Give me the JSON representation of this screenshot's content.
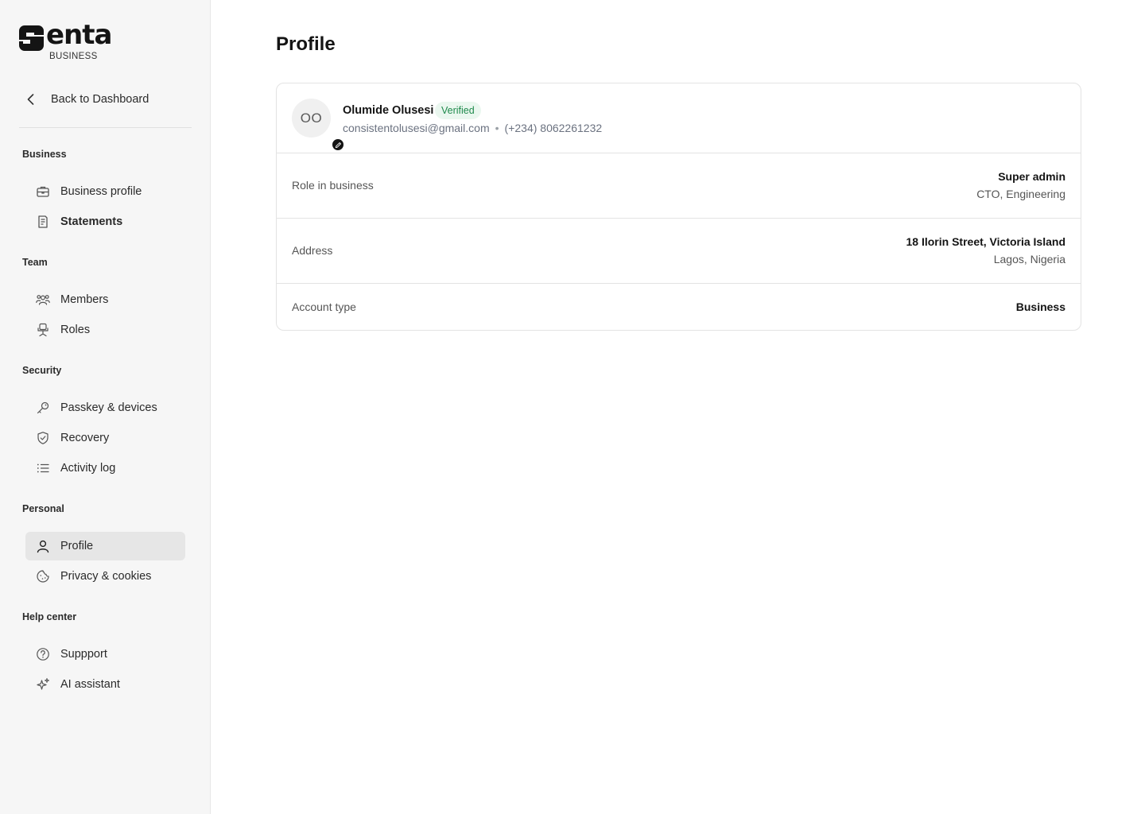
{
  "brand": {
    "name": "enta",
    "subtitle": "BUSINESS"
  },
  "sidebar": {
    "back_label": "Back to Dashboard",
    "sections": [
      {
        "title": "Business",
        "items": [
          {
            "label": "Business profile",
            "icon": "briefcase-icon"
          },
          {
            "label": "Statements",
            "icon": "document-icon"
          }
        ]
      },
      {
        "title": "Team",
        "items": [
          {
            "label": "Members",
            "icon": "users-icon"
          },
          {
            "label": "Roles",
            "icon": "chair-icon"
          }
        ]
      },
      {
        "title": "Security",
        "items": [
          {
            "label": "Passkey & devices",
            "icon": "key-icon"
          },
          {
            "label": "Recovery",
            "icon": "shield-check-icon"
          },
          {
            "label": "Activity log",
            "icon": "list-icon"
          }
        ]
      },
      {
        "title": "Personal",
        "items": [
          {
            "label": "Profile",
            "icon": "user-icon",
            "active": true
          },
          {
            "label": "Privacy & cookies",
            "icon": "cookie-icon"
          }
        ]
      },
      {
        "title": "Help center",
        "items": [
          {
            "label": "Suppport",
            "icon": "help-circle-icon"
          },
          {
            "label": "AI assistant",
            "icon": "sparkles-icon"
          }
        ]
      }
    ]
  },
  "main": {
    "title": "Profile",
    "user": {
      "initials": "OO",
      "name": "Olumide Olusesi",
      "badge": "Verified",
      "email": "consistentolusesi@gmail.com",
      "separator": "•",
      "phone": "(+234) 8062261232"
    },
    "rows": [
      {
        "label": "Role in business",
        "primary": "Super admin",
        "secondary": "CTO, Engineering"
      },
      {
        "label": "Address",
        "primary": "18 Ilorin Street, Victoria Island",
        "secondary": "Lagos, Nigeria"
      },
      {
        "label": "Account type",
        "primary": "Business"
      }
    ]
  },
  "colors": {
    "sidebar_bg": "#f6f6f6",
    "active_item_bg": "#e6e6e6",
    "badge_bg": "#eaf7ef",
    "badge_text": "#1f8a4c",
    "text_primary": "#141414",
    "text_muted": "#6b7280"
  }
}
